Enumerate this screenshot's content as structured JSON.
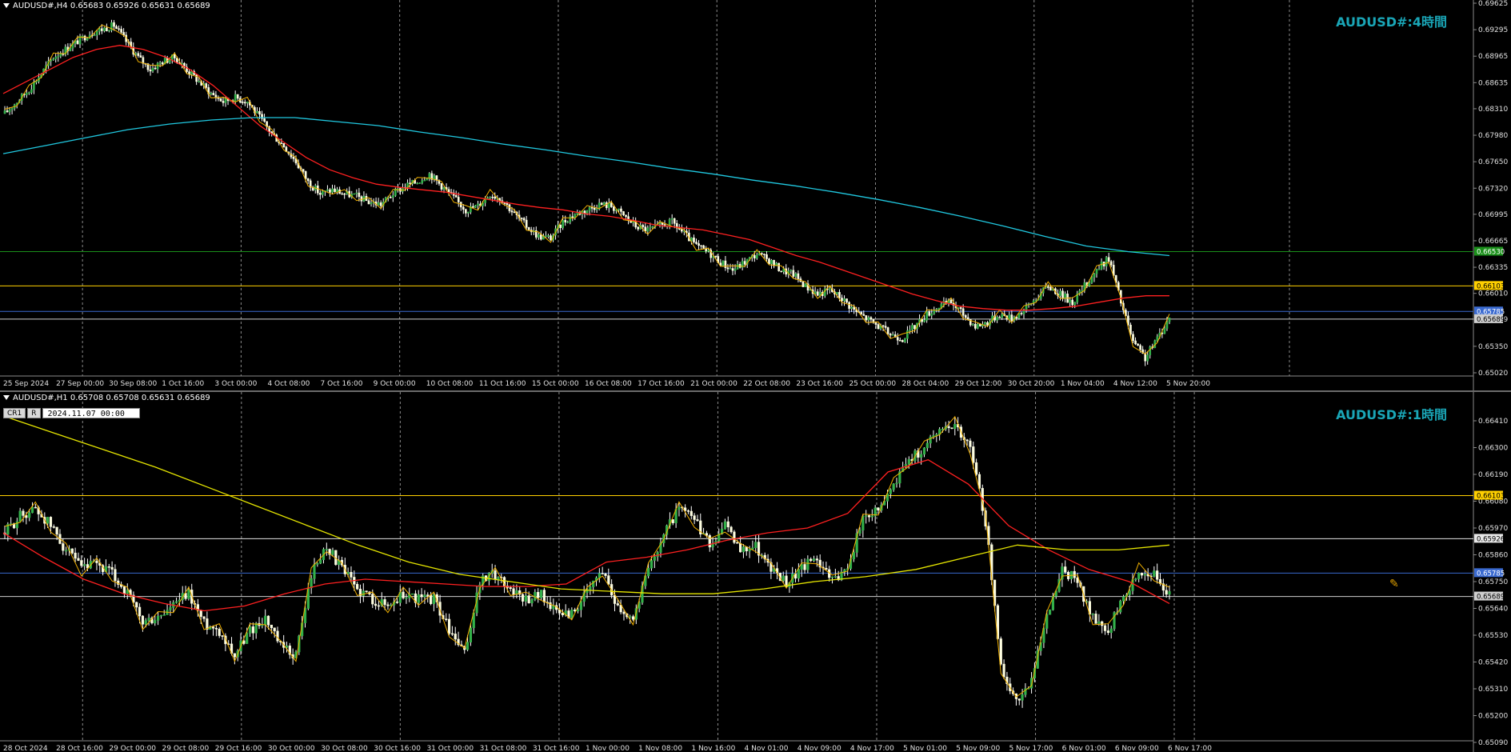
{
  "pane1": {
    "header": "AUDUSD#,H4  0.65683 0.65926 0.65631 0.65689",
    "title": "AUDUSD#:4時間",
    "chart_data": {
      "type": "candlestick",
      "timeframe": "H4",
      "ylim": [
        0.6502,
        0.69625
      ],
      "y_ticks": [
        "0.69625",
        "0.69295",
        "0.68965",
        "0.68635",
        "0.68310",
        "0.67980",
        "0.67650",
        "0.67320",
        "0.66995",
        "0.66665",
        "0.66335",
        "0.66010",
        "0.65689",
        "0.65350",
        "0.65020"
      ],
      "x_labels": [
        "25 Sep 2024",
        "27 Sep 00:00",
        "30 Sep 08:00",
        "1 Oct 16:00",
        "3 Oct 00:00",
        "4 Oct 08:00",
        "7 Oct 16:00",
        "9 Oct 00:00",
        "10 Oct 08:00",
        "11 Oct 16:00",
        "15 Oct 00:00",
        "16 Oct 08:00",
        "17 Oct 16:00",
        "21 Oct 00:00",
        "22 Oct 08:00",
        "23 Oct 16:00",
        "25 Oct 00:00",
        "28 Oct 04:00",
        "29 Oct 12:00",
        "30 Oct 20:00",
        "1 Nov 04:00",
        "4 Nov 12:00",
        "5 Nov 20:00"
      ],
      "close_path": [
        0.6825,
        0.684,
        0.6855,
        0.6875,
        0.6895,
        0.6905,
        0.6915,
        0.6925,
        0.693,
        0.6935,
        0.6915,
        0.6895,
        0.688,
        0.689,
        0.6895,
        0.688,
        0.6865,
        0.685,
        0.684,
        0.6845,
        0.684,
        0.682,
        0.68,
        0.6785,
        0.6765,
        0.674,
        0.6725,
        0.673,
        0.6725,
        0.6722,
        0.6715,
        0.6712,
        0.6725,
        0.6735,
        0.674,
        0.675,
        0.6735,
        0.672,
        0.6705,
        0.671,
        0.6725,
        0.6718,
        0.67,
        0.6685,
        0.6672,
        0.667,
        0.669,
        0.67,
        0.6705,
        0.6712,
        0.671,
        0.6698,
        0.6685,
        0.668,
        0.6685,
        0.669,
        0.6675,
        0.666,
        0.6652,
        0.664,
        0.663,
        0.664,
        0.665,
        0.6642,
        0.663,
        0.6625,
        0.661,
        0.66,
        0.6605,
        0.6595,
        0.658,
        0.657,
        0.656,
        0.655,
        0.6545,
        0.656,
        0.6575,
        0.6585,
        0.659,
        0.6575,
        0.656,
        0.6565,
        0.6575,
        0.657,
        0.658,
        0.6595,
        0.661,
        0.66,
        0.659,
        0.661,
        0.663,
        0.6645,
        0.659,
        0.654,
        0.652,
        0.6545,
        0.657
      ],
      "series": [
        {
          "name": "",
          "color": "#ff2020",
          "values": [
            0.685,
            0.6865,
            0.688,
            0.6895,
            0.6905,
            0.691,
            0.6905,
            0.6895,
            0.688,
            0.686,
            0.6835,
            0.681,
            0.679,
            0.677,
            0.6755,
            0.6745,
            0.6737,
            0.6733,
            0.673,
            0.6727,
            0.6722,
            0.6717,
            0.6712,
            0.6708,
            0.6705,
            0.67,
            0.6697,
            0.6692,
            0.6686,
            0.6683,
            0.668,
            0.6674,
            0.6668,
            0.6658,
            0.6648,
            0.664,
            0.663,
            0.662,
            0.661,
            0.66,
            0.6592,
            0.6585,
            0.6582,
            0.658,
            0.658,
            0.6582,
            0.6585,
            0.659,
            0.6595,
            0.6598,
            0.6598
          ]
        },
        {
          "name": "",
          "color": "#20c8e0",
          "values": [
            0.6775,
            0.6785,
            0.6795,
            0.6805,
            0.6812,
            0.6817,
            0.682,
            0.682,
            0.6815,
            0.681,
            0.6802,
            0.6795,
            0.6787,
            0.678,
            0.6772,
            0.6765,
            0.6757,
            0.675,
            0.6742,
            0.6735,
            0.6727,
            0.6718,
            0.6708,
            0.6697,
            0.6685,
            0.6672,
            0.666,
            0.6653,
            0.6648
          ]
        }
      ],
      "hlines": [
        {
          "label": "0.66530",
          "value": 0.6653,
          "color": "#1a8f1a"
        },
        {
          "label": "0.66103",
          "value": 0.66103,
          "color": "#ffd000"
        },
        {
          "label": "0.65785",
          "value": 0.65785,
          "color": "#3a6ad0"
        },
        {
          "label": "0.65689",
          "value": 0.65689,
          "color": "#cfcfcf"
        }
      ]
    }
  },
  "pane2": {
    "header": "AUDUSD#,H1  0.65708 0.65708 0.65631 0.65689",
    "title": "AUDUSD#:1時間",
    "toolbox": {
      "btn1": "CR1",
      "btn2": "R",
      "date": "2024.11.07 00:00"
    },
    "chart_data": {
      "type": "candlestick",
      "timeframe": "H1",
      "ylim": [
        0.6509,
        0.6641
      ],
      "y_ticks": [
        "0.66410",
        "0.66300",
        "0.66190",
        "0.66080",
        "0.65970",
        "0.65860",
        "0.65750",
        "0.65640",
        "0.65530",
        "0.65420",
        "0.65310",
        "0.65200",
        "0.65090"
      ],
      "x_labels": [
        "28 Oct 2024",
        "28 Oct 16:00",
        "29 Oct 00:00",
        "29 Oct 08:00",
        "29 Oct 16:00",
        "30 Oct 00:00",
        "30 Oct 08:00",
        "30 Oct 16:00",
        "31 Oct 00:00",
        "31 Oct 08:00",
        "31 Oct 16:00",
        "1 Nov 00:00",
        "1 Nov 08:00",
        "1 Nov 16:00",
        "4 Nov 01:00",
        "4 Nov 09:00",
        "4 Nov 17:00",
        "5 Nov 01:00",
        "5 Nov 09:00",
        "5 Nov 17:00",
        "6 Nov 01:00",
        "6 Nov 09:00",
        "6 Nov 17:00"
      ],
      "close_path": [
        0.6595,
        0.6602,
        0.6605,
        0.6598,
        0.6588,
        0.658,
        0.6582,
        0.6578,
        0.657,
        0.6558,
        0.656,
        0.6565,
        0.657,
        0.6558,
        0.6555,
        0.6545,
        0.6555,
        0.656,
        0.6548,
        0.6545,
        0.6578,
        0.659,
        0.658,
        0.6572,
        0.6568,
        0.6565,
        0.657,
        0.6568,
        0.6568,
        0.6555,
        0.6545,
        0.6575,
        0.6578,
        0.6572,
        0.6568,
        0.657,
        0.6562,
        0.6562,
        0.657,
        0.658,
        0.6565,
        0.656,
        0.658,
        0.6595,
        0.6605,
        0.66,
        0.659,
        0.6598,
        0.6588,
        0.659,
        0.658,
        0.6575,
        0.658,
        0.6585,
        0.6575,
        0.6582,
        0.66,
        0.6605,
        0.6615,
        0.6625,
        0.663,
        0.6638,
        0.664,
        0.663,
        0.66,
        0.654,
        0.6525,
        0.6535,
        0.656,
        0.658,
        0.6575,
        0.656,
        0.6555,
        0.6568,
        0.658,
        0.6578,
        0.657
      ],
      "series": [
        {
          "name": "",
          "color": "#ff2020",
          "values": [
            0.6595,
            0.6585,
            0.6576,
            0.657,
            0.6566,
            0.6563,
            0.6565,
            0.657,
            0.6574,
            0.6576,
            0.6575,
            0.6574,
            0.6573,
            0.6573,
            0.6574,
            0.6583,
            0.6585,
            0.6588,
            0.6592,
            0.6595,
            0.6597,
            0.6603,
            0.662,
            0.6625,
            0.6615,
            0.6598,
            0.6588,
            0.658,
            0.6575,
            0.6566
          ]
        },
        {
          "name": "",
          "color": "#e6e600",
          "values": [
            0.6643,
            0.6636,
            0.6629,
            0.6622,
            0.6614,
            0.6606,
            0.6598,
            0.659,
            0.6583,
            0.6578,
            0.6575,
            0.6572,
            0.6571,
            0.657,
            0.657,
            0.6572,
            0.6575,
            0.6577,
            0.658,
            0.6585,
            0.659,
            0.6588,
            0.6588,
            0.659
          ]
        }
      ],
      "hlines": [
        {
          "label": "0.66103",
          "value": 0.66103,
          "color": "#ffd000"
        },
        {
          "label": "0.65926",
          "value": 0.65926,
          "color": "#e6e6e6"
        },
        {
          "label": "0.65785",
          "value": 0.65785,
          "color": "#3a6ad0"
        },
        {
          "label": "0.65689",
          "value": 0.65689,
          "color": "#cfcfcf"
        }
      ]
    }
  }
}
